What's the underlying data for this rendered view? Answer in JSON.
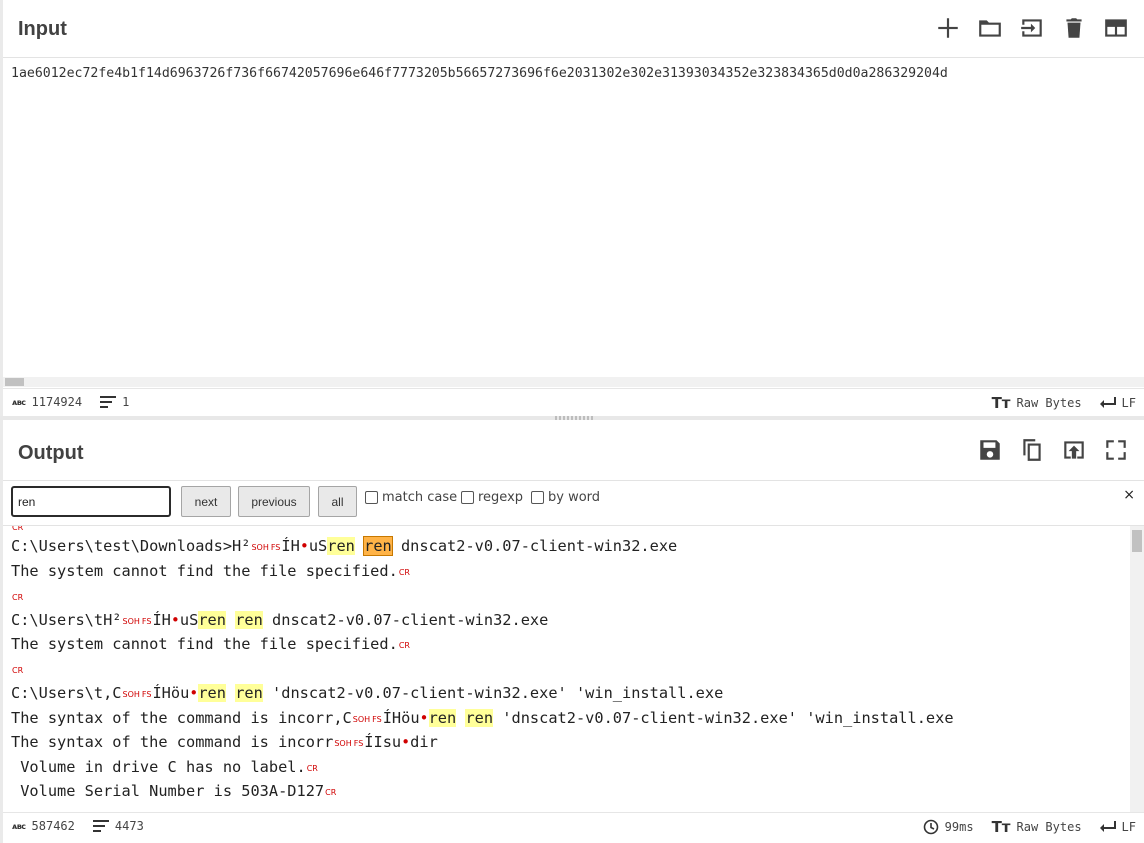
{
  "input": {
    "title": "Input",
    "text": "1ae6012ec72fe4b1f14d6963726f736f66742057696e646f7773205b56657273696f6e2031302e302e31393034352e323834365d0d0a286329204d",
    "status": {
      "length": "1174924",
      "lines": "1",
      "encoding": "Raw Bytes",
      "eol": "LF"
    },
    "icons": [
      "plus-icon",
      "folder-icon",
      "import-icon",
      "trash-icon",
      "layout-icon"
    ]
  },
  "output": {
    "title": "Output",
    "icons": [
      "save-icon",
      "copy-icon",
      "replace-input-icon",
      "fullscreen-icon"
    ],
    "search": {
      "value": "ren",
      "next_label": "next",
      "previous_label": "previous",
      "all_label": "all",
      "match_case_label": "match case",
      "regexp_label": "regexp",
      "by_word_label": "by word",
      "close_label": "×"
    },
    "lines": {
      "l1a": "C:\\Users\\test\\Downloads>H²",
      "l1b": "ÍH",
      "l1c": "uS",
      "l1d": " dnscat2-v0.07-client-win32.exe",
      "l2": "The system cannot find the file specified.",
      "l4a": "C:\\Users\\tH²",
      "l4b": "ÍH",
      "l4c": "uS",
      "l4d": " dnscat2-v0.07-client-win32.exe",
      "l5": "The system cannot find the file specified.",
      "l7a": "C:\\Users\\t,C",
      "l7b": "ÍHöu",
      "l7d": " 'dnscat2-v0.07-client-win32.exe' 'win_install.exe",
      "l8a": "The syntax of the command is incorr,C",
      "l8b": "ÍHöu",
      "l8d": " 'dnscat2-v0.07-client-win32.exe' 'win_install.exe",
      "l9a": "The syntax of the command is incorr",
      "l9b": "ÍIsu",
      "l9c": "dir",
      "l10": " Volume in drive C has no label.",
      "l11": " Volume Serial Number is 503A-D127",
      "match": "ren",
      "ctrl_cr": "CR",
      "ctrl_soh": "SOH",
      "ctrl_fs": "FS",
      "dot": "•"
    },
    "status": {
      "length": "587462",
      "lines": "4473",
      "time": "99ms",
      "encoding": "Raw Bytes",
      "eol": "LF"
    }
  }
}
